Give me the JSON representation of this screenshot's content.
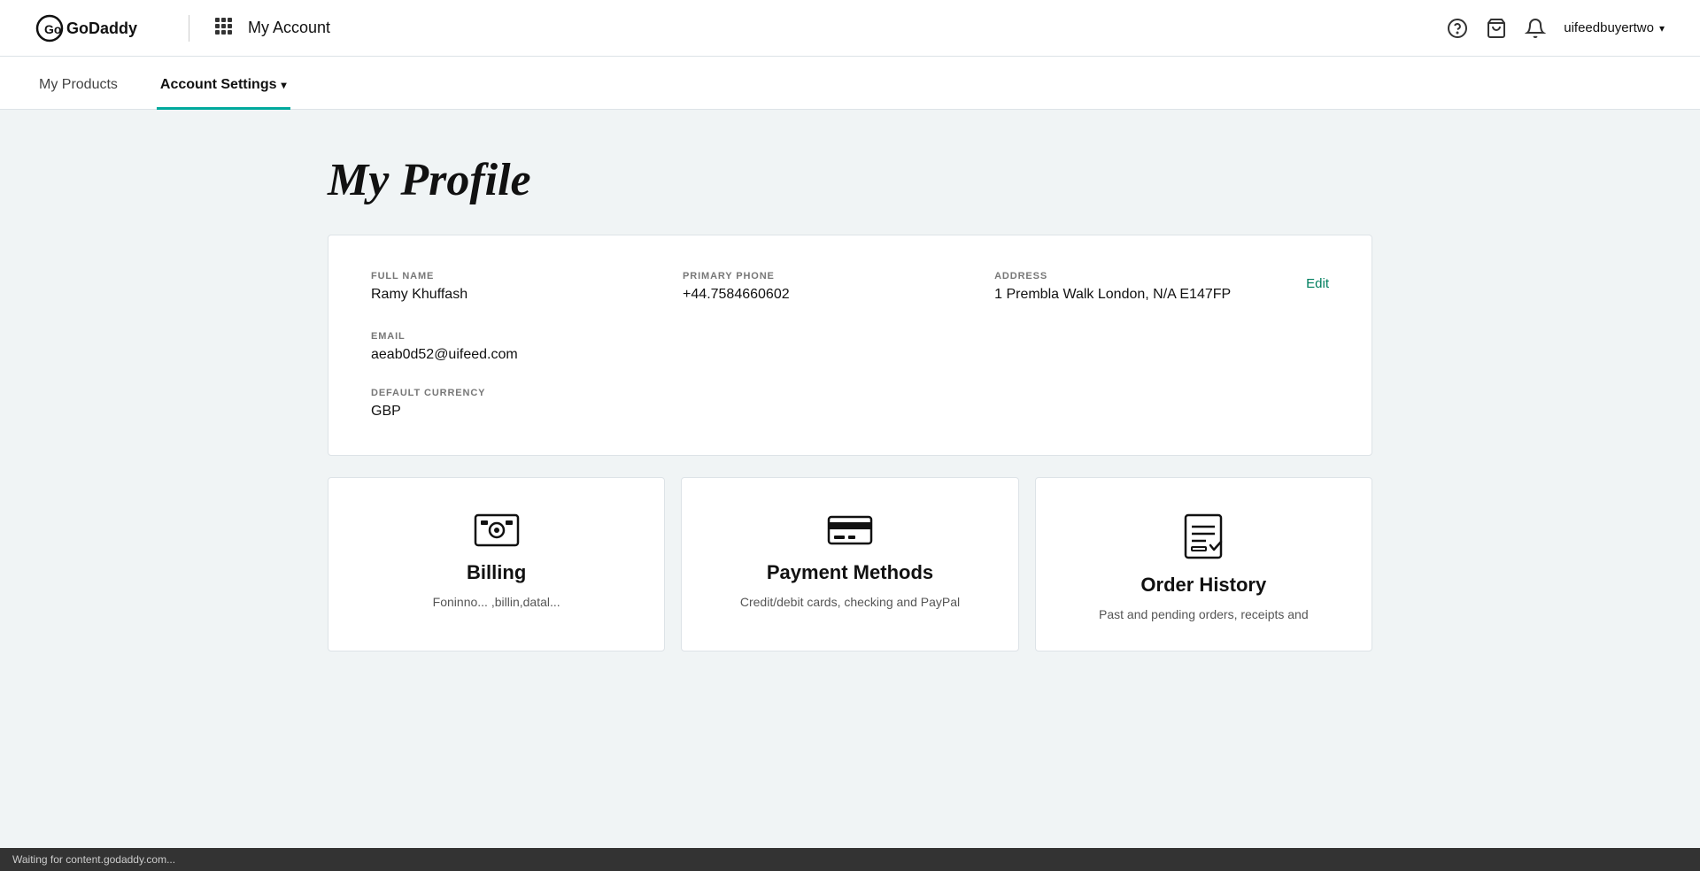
{
  "header": {
    "logo_text": "GoDaddy",
    "divider": true,
    "title": "My Account",
    "icons": {
      "help": "?",
      "cart": "🛒",
      "bell": "🔔"
    },
    "username": "uifeedbuyertwo"
  },
  "nav": {
    "tabs": [
      {
        "id": "my-products",
        "label": "My Products",
        "active": false,
        "has_arrow": false
      },
      {
        "id": "account-settings",
        "label": "Account Settings",
        "active": true,
        "has_arrow": true
      }
    ]
  },
  "profile": {
    "page_title": "My Profile",
    "edit_label": "Edit",
    "fields": {
      "full_name": {
        "label": "FULL NAME",
        "value": "Ramy Khuffash"
      },
      "primary_phone": {
        "label": "PRIMARY PHONE",
        "value": "+44.7584660602"
      },
      "address": {
        "label": "ADDRESS",
        "value": "1 Prembla Walk London, N/A E147FP"
      },
      "email": {
        "label": "EMAIL",
        "value": "aeab0d52@uifeed.com"
      },
      "default_currency": {
        "label": "DEFAULT CURRENCY",
        "value": "GBP"
      }
    }
  },
  "cards": [
    {
      "id": "billing",
      "icon": "billing",
      "title": "Billing",
      "description": "Foninno... ,billin,datal..."
    },
    {
      "id": "payment-methods",
      "icon": "payment",
      "title": "Payment Methods",
      "description": "Credit/debit cards, checking and PayPal"
    },
    {
      "id": "order-history",
      "icon": "order-history",
      "title": "Order History",
      "description": "Past and pending orders, receipts and"
    }
  ],
  "status_bar": {
    "text": "Waiting for content.godaddy.com..."
  }
}
